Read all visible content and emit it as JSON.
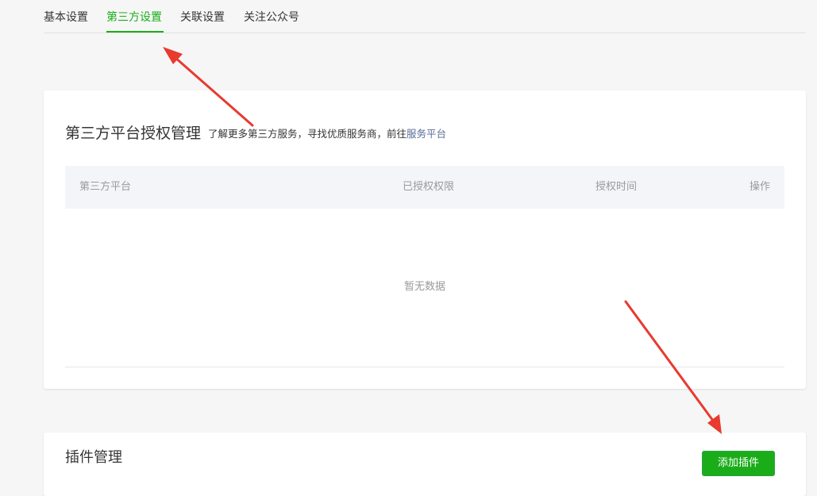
{
  "tabs": [
    {
      "label": "基本设置",
      "active": false
    },
    {
      "label": "第三方设置",
      "active": true
    },
    {
      "label": "关联设置",
      "active": false
    },
    {
      "label": "关注公众号",
      "active": false
    }
  ],
  "auth_section": {
    "title": "第三方平台授权管理",
    "description_prefix": "了解更多第三方服务，寻找优质服务商，前往",
    "description_link": "服务平台",
    "columns": [
      "第三方平台",
      "已授权权限",
      "授权时间",
      "操作"
    ],
    "empty_text": "暂无数据"
  },
  "plugin_section": {
    "title": "插件管理",
    "add_button_label": "添加插件"
  },
  "colors": {
    "accent_green": "#1aad19",
    "link_blue": "#576b95",
    "annotation_red": "#e83a2f"
  }
}
